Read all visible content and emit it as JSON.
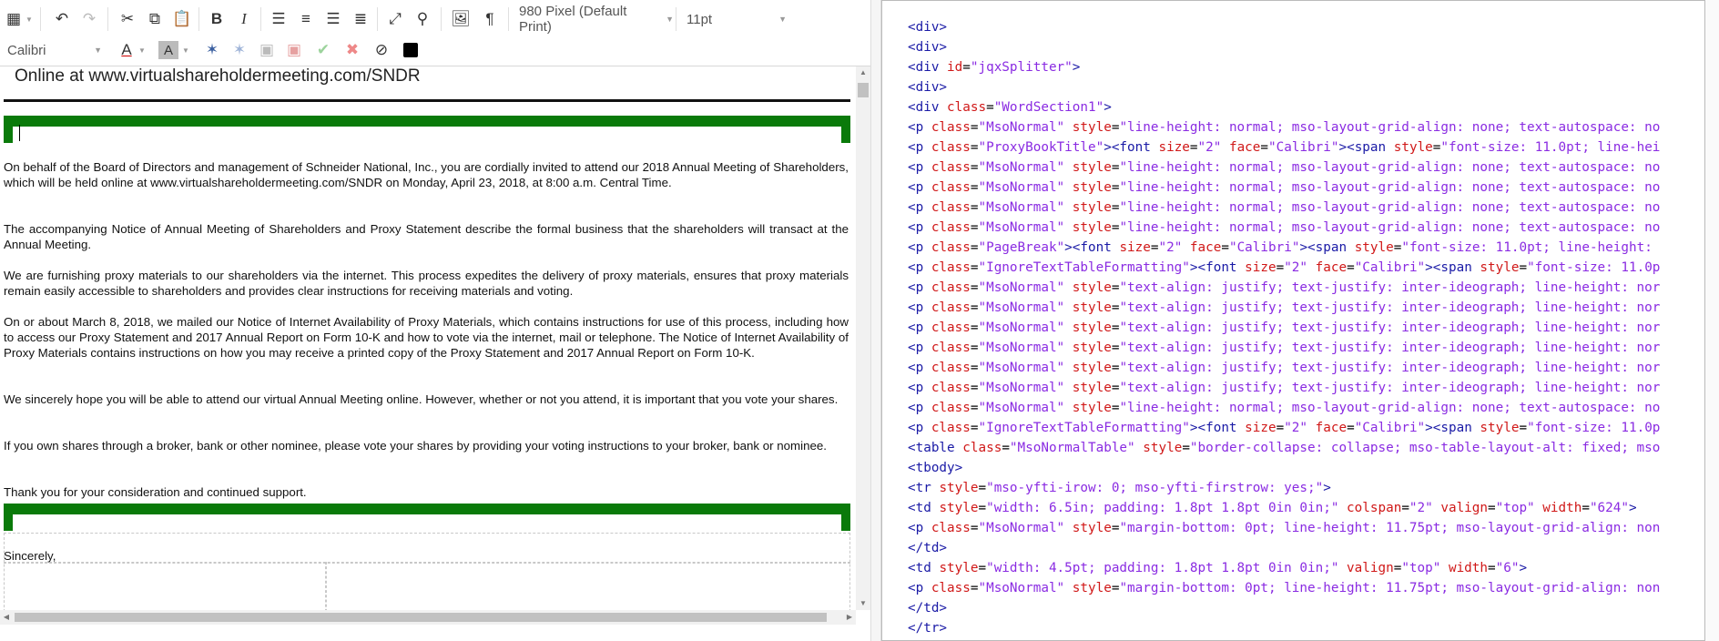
{
  "toolbar": {
    "row1_icons": [
      "table-icon",
      "undo-icon",
      "redo-icon",
      "cut-icon",
      "copy-icon",
      "paste-icon",
      "bold-icon",
      "italic-icon",
      "align-left-icon",
      "align-center-icon",
      "align-right-icon",
      "align-justify-icon",
      "fullscreen-icon",
      "find-icon",
      "image-icon",
      "paragraph-icon"
    ],
    "page_size": "980 Pixel (Default Print)",
    "font_size": "11pt",
    "font_family": "Calibri",
    "row2_icons": [
      "font-color-icon",
      "highlight-color-icon",
      "merge-field-icon",
      "unlink-icon",
      "save-icon",
      "discard-icon",
      "accept-icon",
      "reject-icon",
      "clear-format-icon",
      "html-source-icon"
    ]
  },
  "document": {
    "heading": "Online at www.virtualshareholdermeeting.com/SNDR",
    "paragraphs": [
      "On behalf of the Board of Directors and management of Schneider National, Inc., you are cordially invited to attend our 2018 Annual Meeting of Shareholders, which will be held online at www.virtualshareholdermeeting.com/SNDR on Monday, April 23, 2018, at 8:00 a.m. Central Time.",
      "The accompanying Notice of Annual Meeting of Shareholders and Proxy Statement describe the formal business that the shareholders will transact at the Annual Meeting.",
      "We are furnishing proxy materials to our shareholders via the internet. This process expedites the delivery of proxy materials, ensures that proxy materials remain easily accessible to shareholders and provides clear instructions for receiving materials and voting.",
      "On or about March 8, 2018, we mailed our Notice of Internet Availability of Proxy Materials, which contains instructions for use of this process, including how to access our Proxy Statement and 2017 Annual Report on Form 10-K and how to vote via the internet, mail or telephone. The Notice of Internet Availability of Proxy Materials contains instructions on how you may receive a printed copy of the Proxy Statement and 2017 Annual Report on Form 10-K.",
      "We sincerely hope you will be able to attend our virtual Annual Meeting online. However, whether or not you attend, it is important that you vote your shares.",
      "If you own shares through a broker, bank or other nominee, please vote your shares by providing your voting instructions to your broker, bank or nominee.",
      "Thank you for your consideration and continued support."
    ],
    "closing": "Sincerely,",
    "accent_color": "#0a7a0a"
  },
  "source_lines": [
    [
      [
        "t",
        "<div>"
      ]
    ],
    [
      [
        "t",
        "<div>"
      ]
    ],
    [
      [
        "t",
        "<div "
      ],
      [
        "a",
        "id"
      ],
      [
        "x",
        "="
      ],
      [
        "v",
        "\"jqxSplitter\""
      ],
      [
        "t",
        ">"
      ]
    ],
    [
      [
        "t",
        "<div>"
      ]
    ],
    [
      [
        "t",
        "<div "
      ],
      [
        "a",
        "class"
      ],
      [
        "x",
        "="
      ],
      [
        "v",
        "\"WordSection1\""
      ],
      [
        "t",
        ">"
      ]
    ],
    [
      [
        "t",
        "<p "
      ],
      [
        "a",
        "class"
      ],
      [
        "x",
        "="
      ],
      [
        "v",
        "\"MsoNormal\""
      ],
      [
        "t",
        " "
      ],
      [
        "a",
        "style"
      ],
      [
        "x",
        "="
      ],
      [
        "v",
        "\"line-height: normal; mso-layout-grid-align: none; text-autospace: no"
      ]
    ],
    [
      [
        "t",
        "<p "
      ],
      [
        "a",
        "class"
      ],
      [
        "x",
        "="
      ],
      [
        "v",
        "\"ProxyBookTitle\""
      ],
      [
        "t",
        "><font "
      ],
      [
        "a",
        "size"
      ],
      [
        "x",
        "="
      ],
      [
        "v",
        "\"2\""
      ],
      [
        "t",
        " "
      ],
      [
        "a",
        "face"
      ],
      [
        "x",
        "="
      ],
      [
        "v",
        "\"Calibri\""
      ],
      [
        "t",
        "><span "
      ],
      [
        "a",
        "style"
      ],
      [
        "x",
        "="
      ],
      [
        "v",
        "\"font-size: 11.0pt; line-hei"
      ]
    ],
    [
      [
        "t",
        "<p "
      ],
      [
        "a",
        "class"
      ],
      [
        "x",
        "="
      ],
      [
        "v",
        "\"MsoNormal\""
      ],
      [
        "t",
        " "
      ],
      [
        "a",
        "style"
      ],
      [
        "x",
        "="
      ],
      [
        "v",
        "\"line-height: normal; mso-layout-grid-align: none; text-autospace: no"
      ]
    ],
    [
      [
        "t",
        "<p "
      ],
      [
        "a",
        "class"
      ],
      [
        "x",
        "="
      ],
      [
        "v",
        "\"MsoNormal\""
      ],
      [
        "t",
        " "
      ],
      [
        "a",
        "style"
      ],
      [
        "x",
        "="
      ],
      [
        "v",
        "\"line-height: normal; mso-layout-grid-align: none; text-autospace: no"
      ]
    ],
    [
      [
        "t",
        "<p "
      ],
      [
        "a",
        "class"
      ],
      [
        "x",
        "="
      ],
      [
        "v",
        "\"MsoNormal\""
      ],
      [
        "t",
        " "
      ],
      [
        "a",
        "style"
      ],
      [
        "x",
        "="
      ],
      [
        "v",
        "\"line-height: normal; mso-layout-grid-align: none; text-autospace: no"
      ]
    ],
    [
      [
        "t",
        "<p "
      ],
      [
        "a",
        "class"
      ],
      [
        "x",
        "="
      ],
      [
        "v",
        "\"MsoNormal\""
      ],
      [
        "t",
        " "
      ],
      [
        "a",
        "style"
      ],
      [
        "x",
        "="
      ],
      [
        "v",
        "\"line-height: normal; mso-layout-grid-align: none; text-autospace: no"
      ]
    ],
    [
      [
        "t",
        "<p "
      ],
      [
        "a",
        "class"
      ],
      [
        "x",
        "="
      ],
      [
        "v",
        "\"PageBreak\""
      ],
      [
        "t",
        "><font "
      ],
      [
        "a",
        "size"
      ],
      [
        "x",
        "="
      ],
      [
        "v",
        "\"2\""
      ],
      [
        "t",
        " "
      ],
      [
        "a",
        "face"
      ],
      [
        "x",
        "="
      ],
      [
        "v",
        "\"Calibri\""
      ],
      [
        "t",
        "><span "
      ],
      [
        "a",
        "style"
      ],
      [
        "x",
        "="
      ],
      [
        "v",
        "\"font-size: 11.0pt; line-height:"
      ]
    ],
    [
      [
        "t",
        "<p "
      ],
      [
        "a",
        "class"
      ],
      [
        "x",
        "="
      ],
      [
        "v",
        "\"IgnoreTextTableFormatting\""
      ],
      [
        "t",
        "><font "
      ],
      [
        "a",
        "size"
      ],
      [
        "x",
        "="
      ],
      [
        "v",
        "\"2\""
      ],
      [
        "t",
        " "
      ],
      [
        "a",
        "face"
      ],
      [
        "x",
        "="
      ],
      [
        "v",
        "\"Calibri\""
      ],
      [
        "t",
        "><span "
      ],
      [
        "a",
        "style"
      ],
      [
        "x",
        "="
      ],
      [
        "v",
        "\"font-size: 11.0p"
      ]
    ],
    [
      [
        "t",
        "<p "
      ],
      [
        "a",
        "class"
      ],
      [
        "x",
        "="
      ],
      [
        "v",
        "\"MsoNormal\""
      ],
      [
        "t",
        " "
      ],
      [
        "a",
        "style"
      ],
      [
        "x",
        "="
      ],
      [
        "v",
        "\"text-align: justify; text-justify: inter-ideograph; line-height: nor"
      ]
    ],
    [
      [
        "t",
        "<p "
      ],
      [
        "a",
        "class"
      ],
      [
        "x",
        "="
      ],
      [
        "v",
        "\"MsoNormal\""
      ],
      [
        "t",
        " "
      ],
      [
        "a",
        "style"
      ],
      [
        "x",
        "="
      ],
      [
        "v",
        "\"text-align: justify; text-justify: inter-ideograph; line-height: nor"
      ]
    ],
    [
      [
        "t",
        "<p "
      ],
      [
        "a",
        "class"
      ],
      [
        "x",
        "="
      ],
      [
        "v",
        "\"MsoNormal\""
      ],
      [
        "t",
        " "
      ],
      [
        "a",
        "style"
      ],
      [
        "x",
        "="
      ],
      [
        "v",
        "\"text-align: justify; text-justify: inter-ideograph; line-height: nor"
      ]
    ],
    [
      [
        "t",
        "<p "
      ],
      [
        "a",
        "class"
      ],
      [
        "x",
        "="
      ],
      [
        "v",
        "\"MsoNormal\""
      ],
      [
        "t",
        " "
      ],
      [
        "a",
        "style"
      ],
      [
        "x",
        "="
      ],
      [
        "v",
        "\"text-align: justify; text-justify: inter-ideograph; line-height: nor"
      ]
    ],
    [
      [
        "t",
        "<p "
      ],
      [
        "a",
        "class"
      ],
      [
        "x",
        "="
      ],
      [
        "v",
        "\"MsoNormal\""
      ],
      [
        "t",
        " "
      ],
      [
        "a",
        "style"
      ],
      [
        "x",
        "="
      ],
      [
        "v",
        "\"text-align: justify; text-justify: inter-ideograph; line-height: nor"
      ]
    ],
    [
      [
        "t",
        "<p "
      ],
      [
        "a",
        "class"
      ],
      [
        "x",
        "="
      ],
      [
        "v",
        "\"MsoNormal\""
      ],
      [
        "t",
        " "
      ],
      [
        "a",
        "style"
      ],
      [
        "x",
        "="
      ],
      [
        "v",
        "\"text-align: justify; text-justify: inter-ideograph; line-height: nor"
      ]
    ],
    [
      [
        "t",
        "<p "
      ],
      [
        "a",
        "class"
      ],
      [
        "x",
        "="
      ],
      [
        "v",
        "\"MsoNormal\""
      ],
      [
        "t",
        " "
      ],
      [
        "a",
        "style"
      ],
      [
        "x",
        "="
      ],
      [
        "v",
        "\"line-height: normal; mso-layout-grid-align: none; text-autospace: no"
      ]
    ],
    [
      [
        "t",
        "<p "
      ],
      [
        "a",
        "class"
      ],
      [
        "x",
        "="
      ],
      [
        "v",
        "\"IgnoreTextTableFormatting\""
      ],
      [
        "t",
        "><font "
      ],
      [
        "a",
        "size"
      ],
      [
        "x",
        "="
      ],
      [
        "v",
        "\"2\""
      ],
      [
        "t",
        " "
      ],
      [
        "a",
        "face"
      ],
      [
        "x",
        "="
      ],
      [
        "v",
        "\"Calibri\""
      ],
      [
        "t",
        "><span "
      ],
      [
        "a",
        "style"
      ],
      [
        "x",
        "="
      ],
      [
        "v",
        "\"font-size: 11.0p"
      ]
    ],
    [
      [
        "t",
        "<table "
      ],
      [
        "a",
        "class"
      ],
      [
        "x",
        "="
      ],
      [
        "v",
        "\"MsoNormalTable\""
      ],
      [
        "t",
        " "
      ],
      [
        "a",
        "style"
      ],
      [
        "x",
        "="
      ],
      [
        "v",
        "\"border-collapse: collapse; mso-table-layout-alt: fixed; mso"
      ]
    ],
    [
      [
        "t",
        "<tbody>"
      ]
    ],
    [
      [
        "t",
        "<tr "
      ],
      [
        "a",
        "style"
      ],
      [
        "x",
        "="
      ],
      [
        "v",
        "\"mso-yfti-irow: 0; mso-yfti-firstrow: yes;\""
      ],
      [
        "t",
        ">"
      ]
    ],
    [
      [
        "t",
        "<td "
      ],
      [
        "a",
        "style"
      ],
      [
        "x",
        "="
      ],
      [
        "v",
        "\"width: 6.5in; padding: 1.8pt 1.8pt 0in 0in;\""
      ],
      [
        "t",
        " "
      ],
      [
        "a",
        "colspan"
      ],
      [
        "x",
        "="
      ],
      [
        "v",
        "\"2\""
      ],
      [
        "t",
        " "
      ],
      [
        "a",
        "valign"
      ],
      [
        "x",
        "="
      ],
      [
        "v",
        "\"top\""
      ],
      [
        "t",
        " "
      ],
      [
        "a",
        "width"
      ],
      [
        "x",
        "="
      ],
      [
        "v",
        "\"624\""
      ],
      [
        "t",
        ">"
      ]
    ],
    [
      [
        "t",
        "<p "
      ],
      [
        "a",
        "class"
      ],
      [
        "x",
        "="
      ],
      [
        "v",
        "\"MsoNormal\""
      ],
      [
        "t",
        " "
      ],
      [
        "a",
        "style"
      ],
      [
        "x",
        "="
      ],
      [
        "v",
        "\"margin-bottom: 0pt; line-height: 11.75pt; mso-layout-grid-align: non"
      ]
    ],
    [
      [
        "t",
        "</td>"
      ]
    ],
    [
      [
        "t",
        "<td "
      ],
      [
        "a",
        "style"
      ],
      [
        "x",
        "="
      ],
      [
        "v",
        "\"width: 4.5pt; padding: 1.8pt 1.8pt 0in 0in;\""
      ],
      [
        "t",
        " "
      ],
      [
        "a",
        "valign"
      ],
      [
        "x",
        "="
      ],
      [
        "v",
        "\"top\""
      ],
      [
        "t",
        " "
      ],
      [
        "a",
        "width"
      ],
      [
        "x",
        "="
      ],
      [
        "v",
        "\"6\""
      ],
      [
        "t",
        ">"
      ]
    ],
    [
      [
        "t",
        "<p "
      ],
      [
        "a",
        "class"
      ],
      [
        "x",
        "="
      ],
      [
        "v",
        "\"MsoNormal\""
      ],
      [
        "t",
        " "
      ],
      [
        "a",
        "style"
      ],
      [
        "x",
        "="
      ],
      [
        "v",
        "\"margin-bottom: 0pt; line-height: 11.75pt; mso-layout-grid-align: non"
      ]
    ],
    [
      [
        "t",
        "</td>"
      ]
    ],
    [
      [
        "t",
        "</tr>"
      ]
    ]
  ]
}
